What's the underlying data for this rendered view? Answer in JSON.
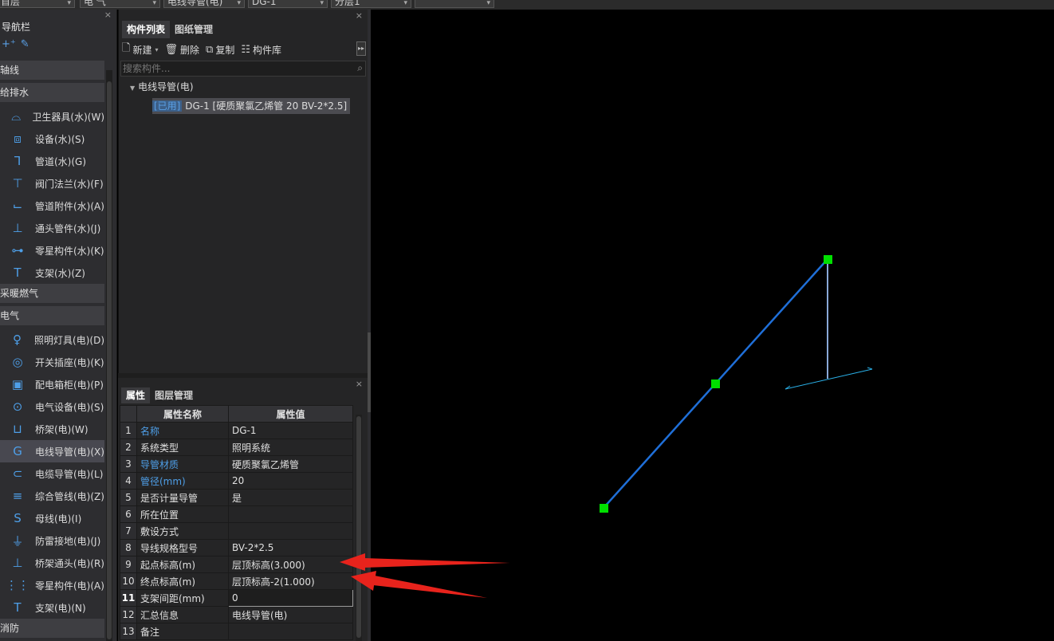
{
  "top_selectors": [
    {
      "value": "首层"
    },
    {
      "value": "电 气"
    },
    {
      "value": "电线导管(电)"
    },
    {
      "value": "DG-1"
    },
    {
      "value": "分层1"
    },
    {
      "value": ""
    }
  ],
  "nav": {
    "title": "导航栏",
    "close": "×",
    "groups": [
      {
        "label": "轴线",
        "items": []
      },
      {
        "label": "给排水",
        "items": [
          {
            "label": "卫生器具(水)(W)",
            "icon": "sanitary-icon",
            "glyph": "⌓"
          },
          {
            "label": "设备(水)(S)",
            "icon": "equipment-icon",
            "glyph": "⧈"
          },
          {
            "label": "管道(水)(G)",
            "icon": "pipe-icon",
            "glyph": "⅂"
          },
          {
            "label": "阀门法兰(水)(F)",
            "icon": "valve-icon",
            "glyph": "⊤"
          },
          {
            "label": "管道附件(水)(A)",
            "icon": "pipe-accessory-icon",
            "glyph": "⌙"
          },
          {
            "label": "通头管件(水)(J)",
            "icon": "fitting-icon",
            "glyph": "⊥"
          },
          {
            "label": "零星构件(水)(K)",
            "icon": "misc-part-icon",
            "glyph": "⊶"
          },
          {
            "label": "支架(水)(Z)",
            "icon": "support-icon",
            "glyph": "T"
          }
        ]
      },
      {
        "label": "采暖燃气",
        "items": []
      },
      {
        "label": "电气",
        "items": [
          {
            "label": "照明灯具(电)(D)",
            "icon": "lamp-icon",
            "glyph": "♀"
          },
          {
            "label": "开关插座(电)(K)",
            "icon": "switch-socket-icon",
            "glyph": "◎"
          },
          {
            "label": "配电箱柜(电)(P)",
            "icon": "distribution-box-icon",
            "glyph": "▣"
          },
          {
            "label": "电气设备(电)(S)",
            "icon": "electrical-device-icon",
            "glyph": "⊙"
          },
          {
            "label": "桥架(电)(W)",
            "icon": "cable-tray-icon",
            "glyph": "⊔"
          },
          {
            "label": "电线导管(电)(X)",
            "icon": "conduit-icon",
            "glyph": "G",
            "active": true
          },
          {
            "label": "电缆导管(电)(L)",
            "icon": "cable-conduit-icon",
            "glyph": "⊂"
          },
          {
            "label": "综合管线(电)(Z)",
            "icon": "combined-pipeline-icon",
            "glyph": "≡"
          },
          {
            "label": "母线(电)(I)",
            "icon": "busbar-icon",
            "glyph": "S"
          },
          {
            "label": "防雷接地(电)(J)",
            "icon": "lightning-ground-icon",
            "glyph": "⏚"
          },
          {
            "label": "桥架通头(电)(R)",
            "icon": "tray-fitting-icon",
            "glyph": "⊥"
          },
          {
            "label": "零星构件(电)(A)",
            "icon": "misc-grid-icon",
            "glyph": "⋮⋮"
          },
          {
            "label": "支架(电)(N)",
            "icon": "support-icon",
            "glyph": "T"
          }
        ]
      },
      {
        "label": "消防",
        "items": []
      }
    ]
  },
  "component_panel": {
    "tabs": [
      "构件列表",
      "图纸管理"
    ],
    "toolbar": {
      "new": "新建",
      "delete": "删除",
      "copy": "复制",
      "library": "构件库"
    },
    "search_placeholder": "搜索构件...",
    "tree_root": "电线导管(电)",
    "tree_leaf_tag": "[已用]",
    "tree_leaf": "DG-1 [硬质聚氯乙烯管 20 BV-2*2.5]"
  },
  "properties_panel": {
    "tabs": [
      "属性",
      "图层管理"
    ],
    "headers": {
      "name": "属性名称",
      "value": "属性值"
    },
    "rows": [
      {
        "no": "1",
        "name": "名称",
        "value": "DG-1",
        "blue": true
      },
      {
        "no": "2",
        "name": "系统类型",
        "value": "照明系统",
        "blue": false
      },
      {
        "no": "3",
        "name": "导管材质",
        "value": "硬质聚氯乙烯管",
        "blue": true
      },
      {
        "no": "4",
        "name": "管径(mm)",
        "value": "20",
        "blue": true
      },
      {
        "no": "5",
        "name": "是否计量导管",
        "value": "是",
        "blue": false
      },
      {
        "no": "6",
        "name": "所在位置",
        "value": "",
        "blue": false
      },
      {
        "no": "7",
        "name": "敷设方式",
        "value": "",
        "blue": false
      },
      {
        "no": "8",
        "name": "导线规格型号",
        "value": "BV-2*2.5",
        "blue": false
      },
      {
        "no": "9",
        "name": "起点标高(m)",
        "value": "层顶标高(3.000)",
        "blue": false
      },
      {
        "no": "10",
        "name": "终点标高(m)",
        "value": "层顶标高-2(1.000)",
        "blue": false
      },
      {
        "no": "11",
        "name": "支架间距(mm)",
        "value": "0",
        "blue": false,
        "editing": true
      },
      {
        "no": "12",
        "name": "汇总信息",
        "value": "电线导管(电)",
        "blue": false
      },
      {
        "no": "13",
        "name": "备注",
        "value": "",
        "blue": false
      }
    ]
  },
  "colors": {
    "conduit": "#1f6fd8",
    "node": "#00e000",
    "riser": "#8aa8d8",
    "axis": "#2ab0e8",
    "annotation_arrow": "#e8231c"
  }
}
